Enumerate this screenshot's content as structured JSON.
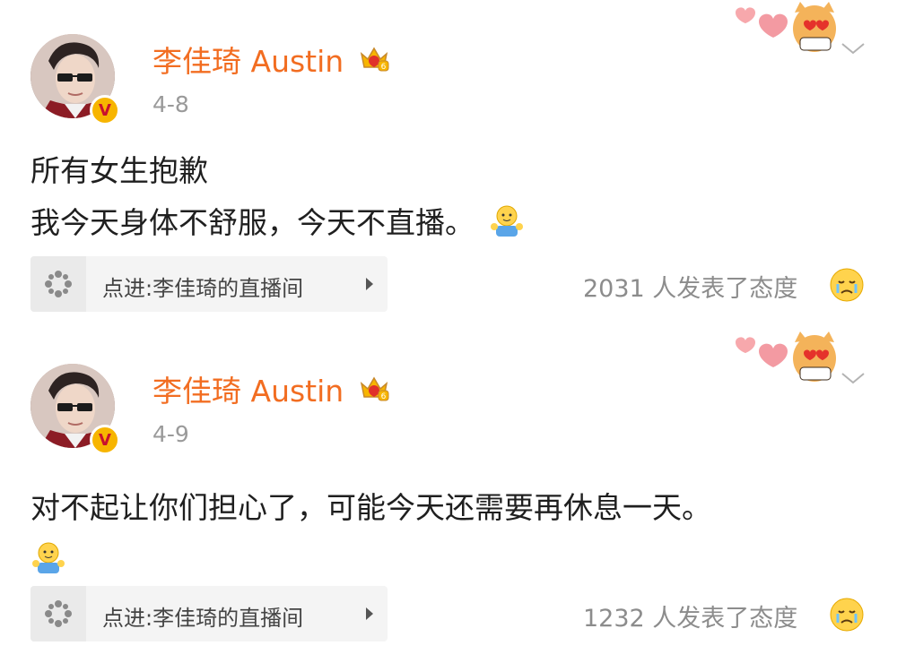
{
  "posts": [
    {
      "username": "李佳琦 Austin",
      "date": "4-8",
      "verified_badge": "V",
      "content_lines": [
        "所有女生抱歉",
        "我今天身体不舒服，今天不直播。"
      ],
      "live_link": "点进:李佳琦的直播间",
      "reactions": "2031 人发表了态度"
    },
    {
      "username": "李佳琦 Austin",
      "date": "4-9",
      "verified_badge": "V",
      "content_lines": [
        "对不起让你们担心了，可能今天还需要再休息一天。"
      ],
      "live_link": "点进:李佳琦的直播间",
      "reactions": "1232 人发表了态度"
    }
  ],
  "colors": {
    "username": "#f26d21",
    "date": "#9a9a9a",
    "badge_gold": "#f7b500",
    "badge_red": "#c8102e",
    "livebar_bg": "#f4f4f4"
  },
  "icons": {
    "crown": "vip-crown-icon",
    "decoration": "hearts-cat-decoration-icon",
    "chevron": "chevron-down-icon",
    "live": "pinwheel-live-icon",
    "inline_emoji": "hug-emoji-icon",
    "reaction_emoji": "crying-face-emoji-icon"
  }
}
